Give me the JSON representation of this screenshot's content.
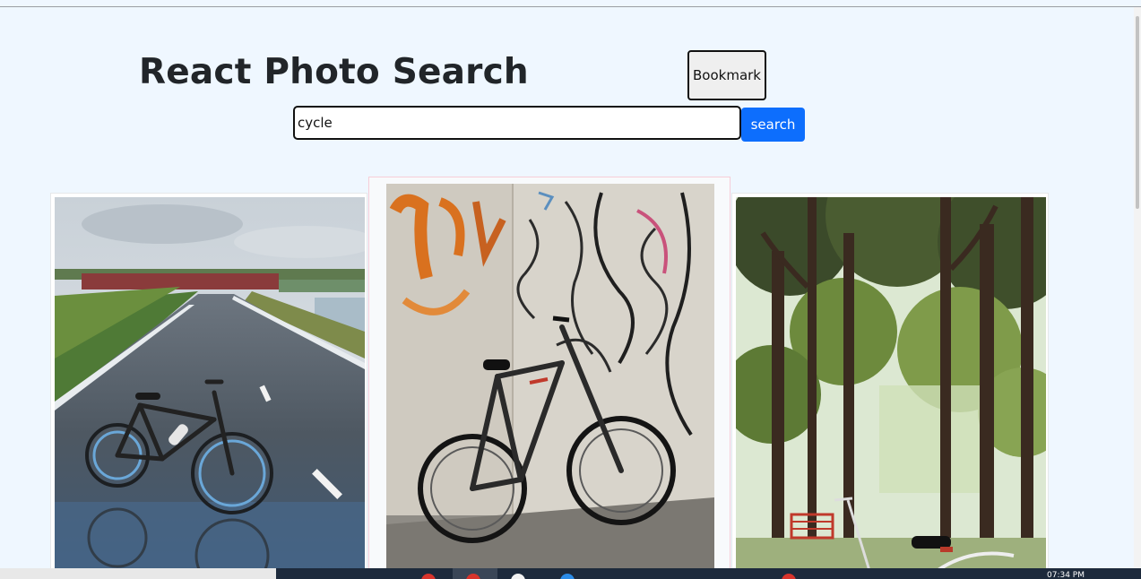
{
  "header": {
    "title": "React Photo Search",
    "bookmark_label": "Bookmark"
  },
  "search": {
    "value": "cycle",
    "button_label": "search"
  },
  "photos": [
    {
      "subject": "bicycle on wet road"
    },
    {
      "subject": "bicycle against graffiti wall"
    },
    {
      "subject": "bicycle under trees"
    }
  ],
  "taskbar": {
    "clock": "07:34 PM"
  },
  "colors": {
    "page_background": "#eff7ff",
    "search_button": "#0d6efd",
    "taskbar": "#1d2a3c"
  }
}
